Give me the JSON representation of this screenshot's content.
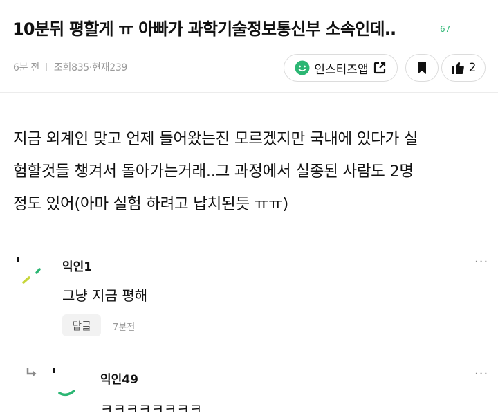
{
  "post": {
    "title": "10분뒤 평할게 ㅠ 아빠가 과학기술정보통신부 소속인데..",
    "title_count": "67",
    "meta_time": "6분 전",
    "meta_views": "조회835·현재239",
    "app_button_label": "인스티즈앱",
    "like_count": "2",
    "body_lines": [
      "지금 외계인 맞고 언제 들어왔는진 모르겠지만 국내에 있다가 실",
      "험할것들 챙겨서 돌아가는거래..그 과정에서 실종된 사람도 2명",
      "정도 있어(아마 실험 하려고 납치된듯 ㅠㅠ)"
    ]
  },
  "comments": [
    {
      "name": "익인1",
      "text": "그냥 지금 평해",
      "reply_label": "답글",
      "time": "7분전",
      "more": "···"
    },
    {
      "name": "익인49",
      "text": "ㅋㅋㅋㅋㅋㅋㅋㅋ",
      "more": "···"
    }
  ],
  "colors": {
    "accent": "#2bb673",
    "avatar_yellow": "#c7d63a",
    "text": "#111111",
    "muted": "#9a9a9a"
  },
  "icons": [
    "smiley-icon",
    "share-icon",
    "bookmark-icon",
    "thumbs-up-icon",
    "reply-arrow-icon",
    "more-icon"
  ]
}
